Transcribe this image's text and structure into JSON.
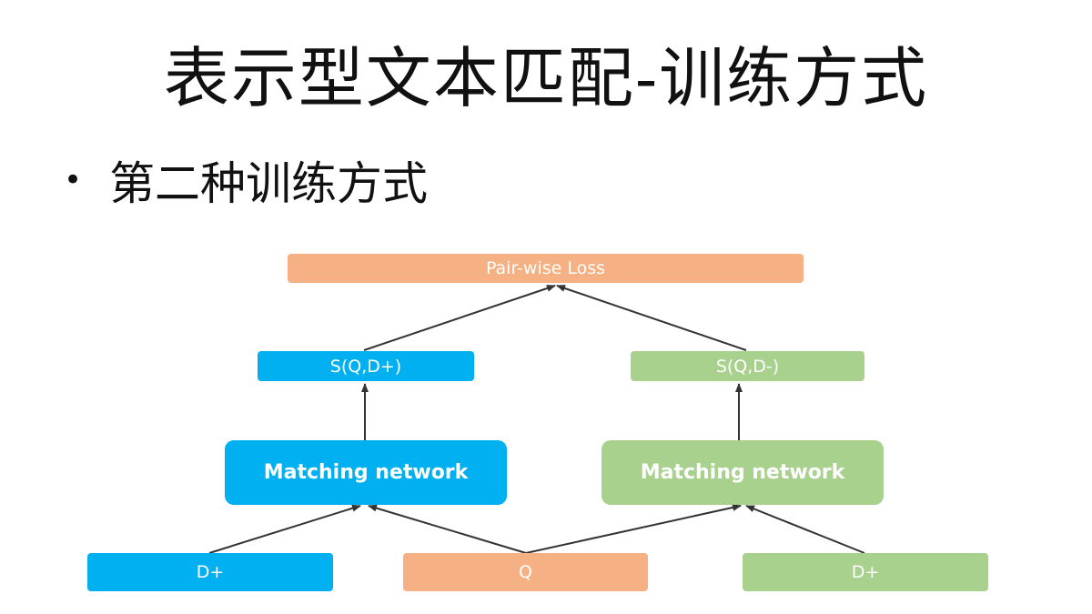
{
  "slide": {
    "title": "表示型文本匹配-训练方式",
    "bullet": "第二种训练方式"
  },
  "diagram": {
    "loss": "Pair-wise Loss",
    "score_pos": "S(Q,D+)",
    "score_neg": "S(Q,D-)",
    "net_left": "Matching network",
    "net_right": "Matching network",
    "input_pos": "D+",
    "input_query": "Q",
    "input_pos_right": "D+"
  },
  "colors": {
    "orange": "#f5b183",
    "blue": "#00b0f0",
    "green": "#a9d18e",
    "arrow": "#333333"
  }
}
